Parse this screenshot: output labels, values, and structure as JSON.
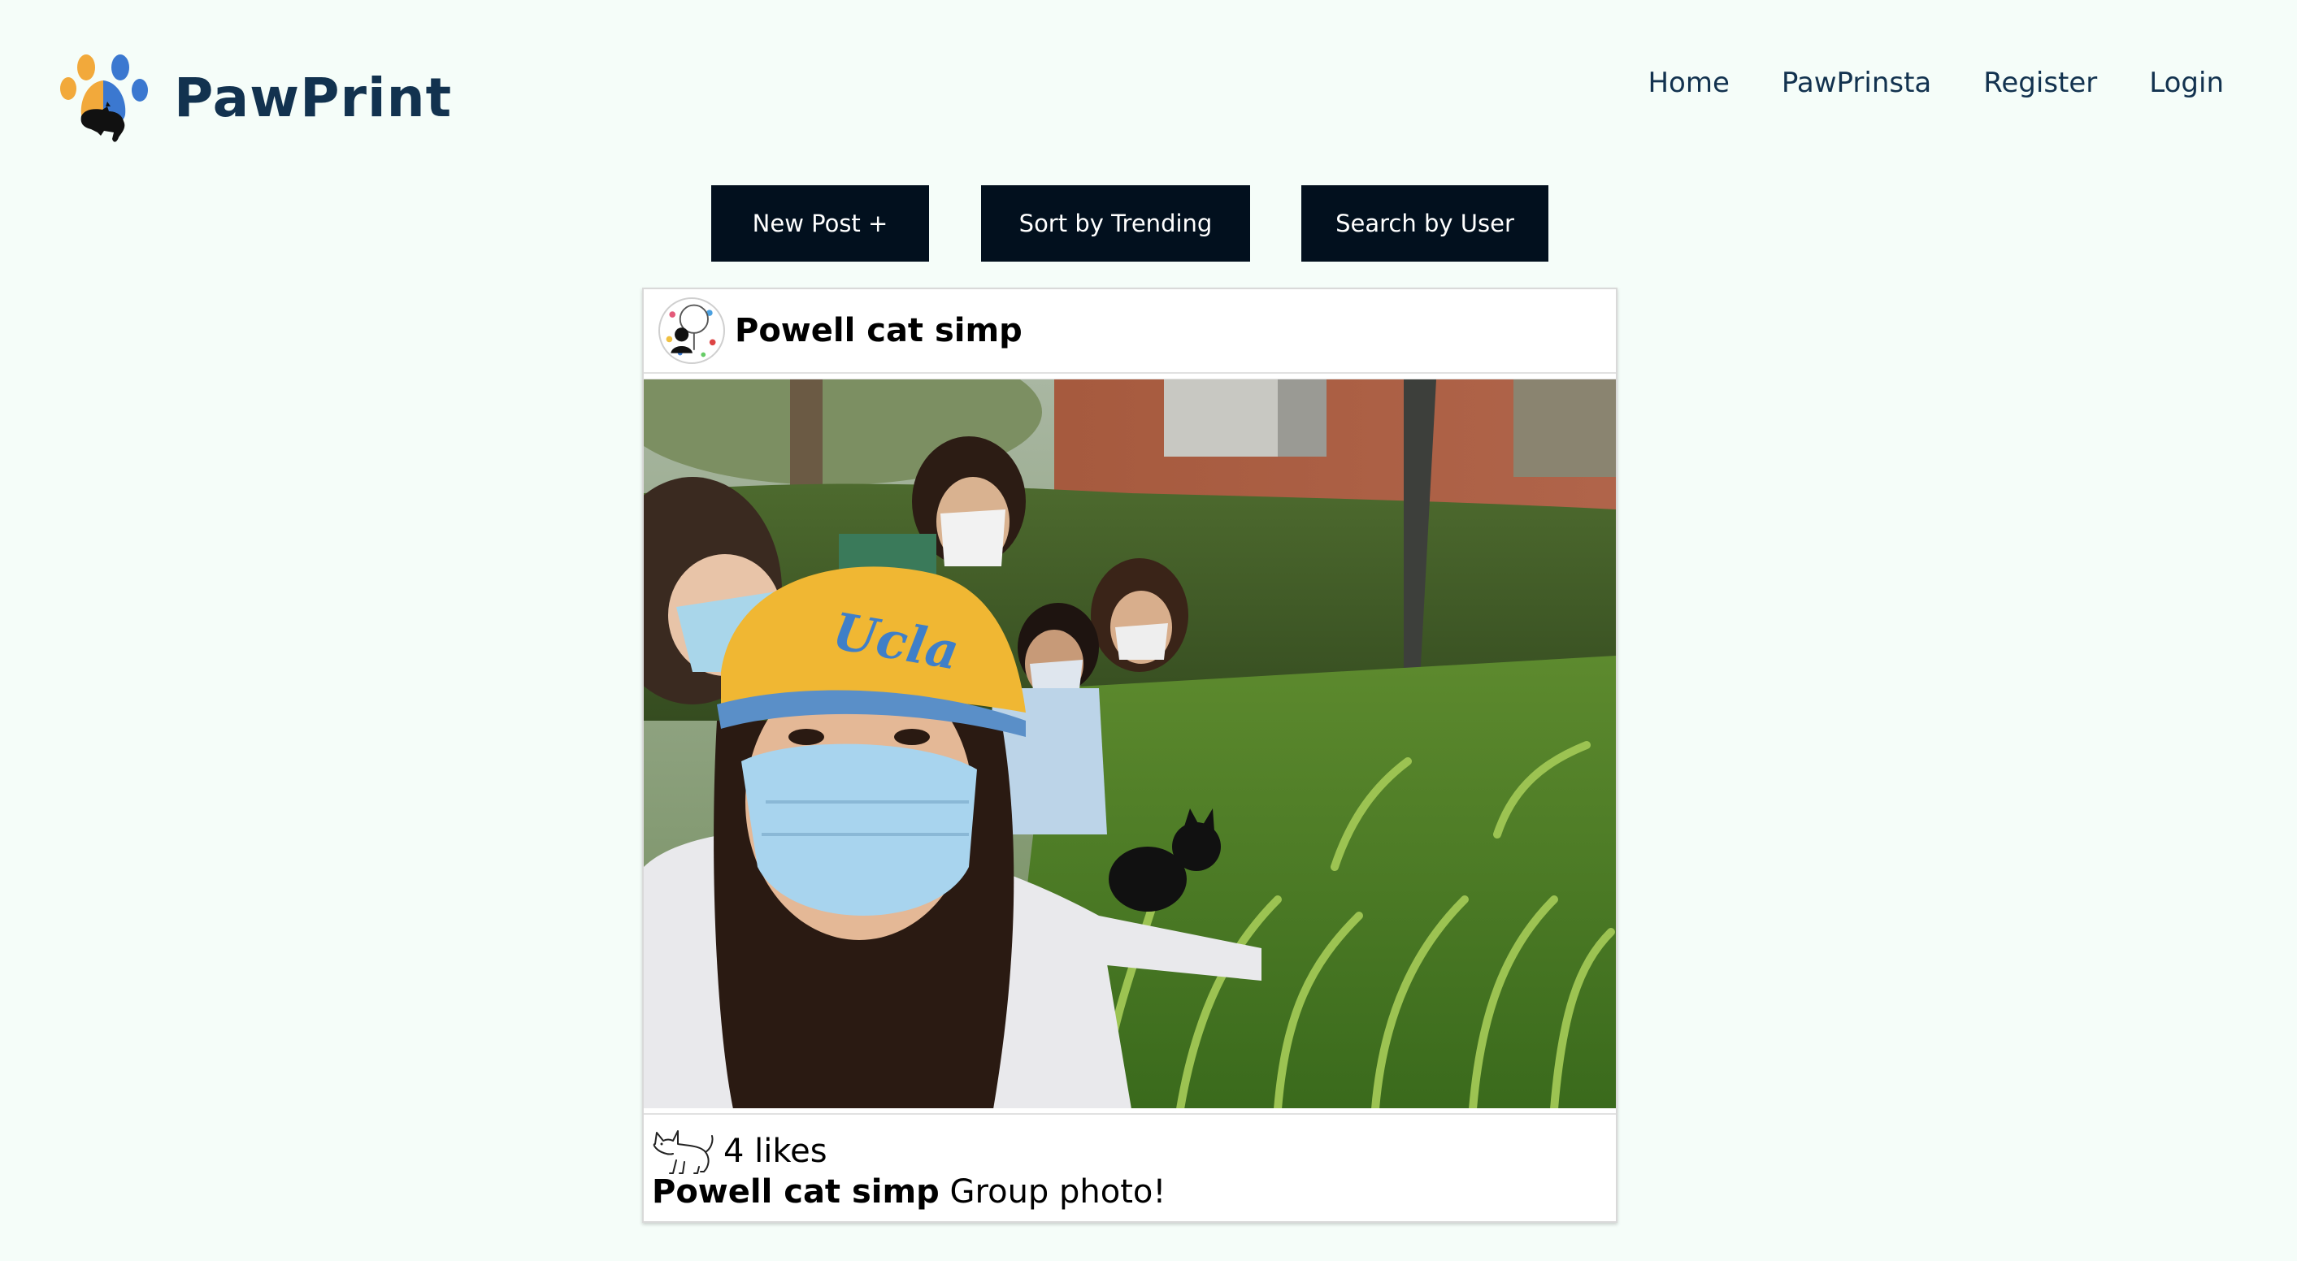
{
  "header": {
    "brand_name": "PawPrint",
    "logo_icon": "paw-cat-logo-icon",
    "nav": [
      "Home",
      "PawPrinsta",
      "Register",
      "Login"
    ]
  },
  "actions": {
    "new_post": "New Post +",
    "sort": "Sort by Trending",
    "search": "Search by User"
  },
  "post": {
    "username": "Powell cat simp",
    "likes": "4 likes",
    "caption_user": "Powell cat simp",
    "caption_text": "Group photo!",
    "like_icon": "cat-outline-icon"
  },
  "colors": {
    "background": "#f5fdf9",
    "brand": "#12324f",
    "button": "#02101e"
  }
}
